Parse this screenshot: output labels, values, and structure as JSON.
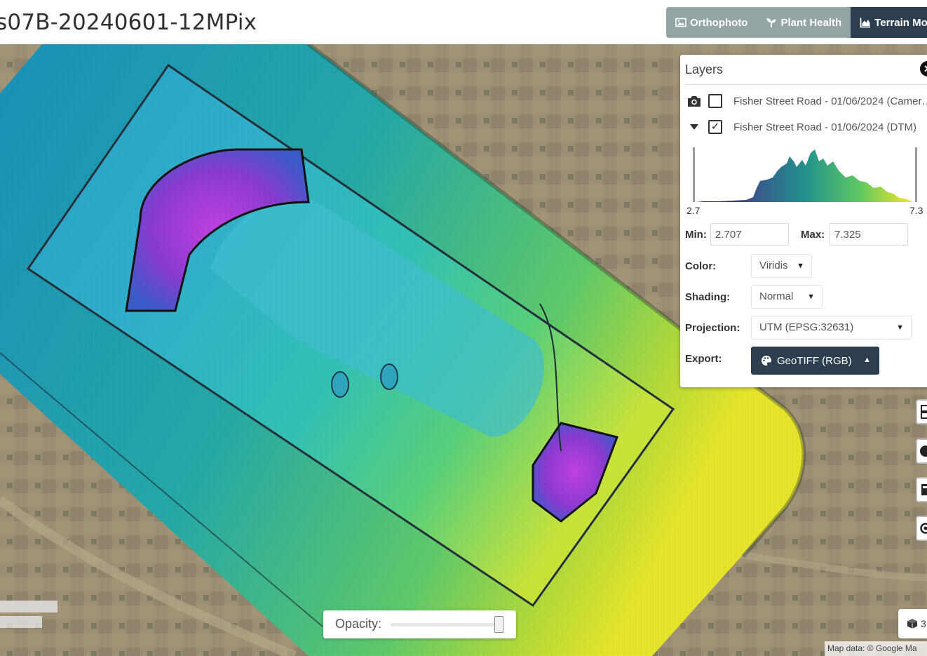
{
  "header": {
    "title": "s07B-20240601-12MPix",
    "tabs": [
      {
        "label": "Orthophoto",
        "icon": "image-icon"
      },
      {
        "label": "Plant Health",
        "icon": "seedling-icon"
      },
      {
        "label": "Terrain Mo",
        "icon": "chart-area-icon"
      }
    ]
  },
  "layers_panel": {
    "title": "Layers",
    "close_icon": "close-icon",
    "items": [
      {
        "label": "Fisher Street Road - 01/06/2024 (Camer…",
        "checked": false,
        "icon": "camera-icon"
      },
      {
        "label": "Fisher Street Road - 01/06/2024 (DTM)",
        "checked": true,
        "icon": "caret-down-icon"
      }
    ],
    "histogram": {
      "min_label": "2.7",
      "max_label": "7.3"
    },
    "min_label": "Min:",
    "min_value": "2.707",
    "max_label": "Max:",
    "max_value": "7.325",
    "color_label": "Color:",
    "color_value": "Viridis",
    "shading_label": "Shading:",
    "shading_value": "Normal",
    "projection_label": "Projection:",
    "projection_value": "UTM (EPSG:32631)",
    "export_label": "Export:",
    "export_button": "GeoTIFF (RGB)",
    "export_icon": "palette-icon"
  },
  "map_controls": {
    "opacity_label": "Opacity:",
    "opacity_value": 1.0,
    "threed_label": "3",
    "attribution": "Map data: © Google Ma"
  }
}
